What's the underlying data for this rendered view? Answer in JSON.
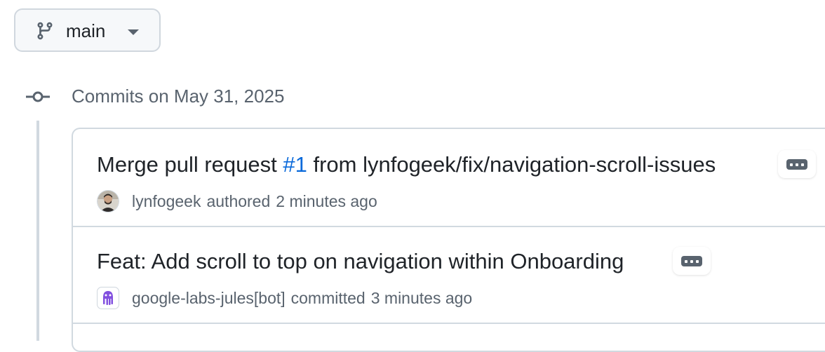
{
  "branch": {
    "name": "main",
    "icon": "git-branch-icon"
  },
  "commit_group": {
    "heading": "Commits on May 31, 2025",
    "icon": "git-commit-icon"
  },
  "commits": [
    {
      "title_prefix": "Merge pull request ",
      "pr_link": "#1",
      "title_suffix": " from lynfogeek/fix/navigation-scroll-issues",
      "author": "lynfogeek",
      "action": "authored",
      "time": "2 minutes ago",
      "avatar": "user-avatar"
    },
    {
      "title": "Feat: Add scroll to top on navigation within Onboarding",
      "author": "google-labs-jules[bot]",
      "action": "committed",
      "time": "3 minutes ago",
      "avatar": "bot-avatar"
    }
  ],
  "colors": {
    "link": "#0969da",
    "muted": "#59636e",
    "border": "#d1d9e0",
    "bot_avatar": "#8250df"
  }
}
